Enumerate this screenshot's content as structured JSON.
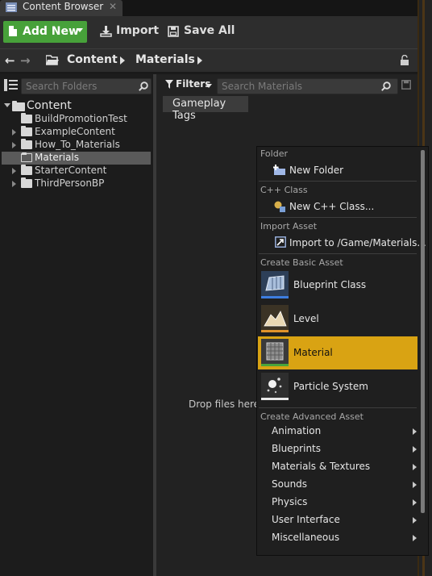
{
  "tab": {
    "title": "Content Browser",
    "close": "✕"
  },
  "toolbar": {
    "add_new": "Add New",
    "import": "Import",
    "save_all": "Save All"
  },
  "path": {
    "crumbs": [
      "Content",
      "Materials"
    ]
  },
  "folders_search": {
    "placeholder": "Search Folders"
  },
  "tree": {
    "root": "Content",
    "items": [
      "BuildPromotionTest",
      "ExampleContent",
      "How_To_Materials",
      "Materials",
      "StarterContent",
      "ThirdPersonBP"
    ]
  },
  "assets": {
    "filters": "Filters",
    "search_placeholder": "Search Materials",
    "tag": "Gameplay Tags",
    "drop_text": "Drop files here o"
  },
  "menu": {
    "folder_header": "Folder",
    "new_folder": "New Folder",
    "cpp_header": "C++ Class",
    "new_cpp": "New C++ Class...",
    "import_header": "Import Asset",
    "import_to": "Import to /Game/Materials...",
    "basic_header": "Create Basic Asset",
    "basic": [
      "Blueprint Class",
      "Level",
      "Material",
      "Particle System"
    ],
    "advanced_header": "Create Advanced Asset",
    "advanced": [
      "Animation",
      "Blueprints",
      "Materials & Textures",
      "Sounds",
      "Physics",
      "User Interface",
      "Miscellaneous"
    ]
  },
  "colors": {
    "add_new": "#47a13a",
    "highlight": "#d9a313"
  }
}
